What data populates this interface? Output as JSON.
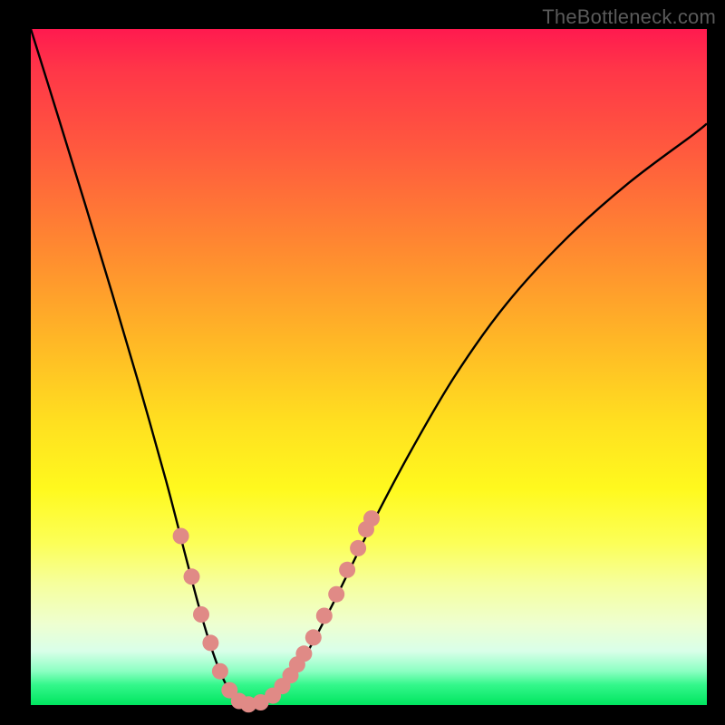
{
  "watermark": {
    "text": "TheBottleneck.com"
  },
  "colors": {
    "curve_stroke": "#000000",
    "marker_fill": "#e08a86",
    "marker_stroke": "#d67670"
  },
  "chart_data": {
    "type": "line",
    "title": "",
    "xlabel": "",
    "ylabel": "",
    "xlim": [
      0,
      1
    ],
    "ylim": [
      0,
      1
    ],
    "series": [
      {
        "name": "bottleneck-curve",
        "x": [
          0.0,
          0.04,
          0.08,
          0.12,
          0.16,
          0.2,
          0.228,
          0.248,
          0.264,
          0.278,
          0.29,
          0.3,
          0.312,
          0.326,
          0.342,
          0.36,
          0.382,
          0.41,
          0.448,
          0.5,
          0.56,
          0.628,
          0.704,
          0.79,
          0.884,
          0.98,
          1.0
        ],
        "y": [
          1.0,
          0.872,
          0.742,
          0.61,
          0.474,
          0.332,
          0.224,
          0.148,
          0.094,
          0.054,
          0.028,
          0.012,
          0.003,
          0.001,
          0.004,
          0.014,
          0.036,
          0.08,
          0.152,
          0.258,
          0.372,
          0.488,
          0.594,
          0.688,
          0.772,
          0.844,
          0.86
        ]
      }
    ],
    "markers": [
      {
        "x": 0.222,
        "y": 0.25
      },
      {
        "x": 0.238,
        "y": 0.19
      },
      {
        "x": 0.252,
        "y": 0.134
      },
      {
        "x": 0.266,
        "y": 0.092
      },
      {
        "x": 0.28,
        "y": 0.05
      },
      {
        "x": 0.294,
        "y": 0.022
      },
      {
        "x": 0.308,
        "y": 0.006
      },
      {
        "x": 0.322,
        "y": 0.001
      },
      {
        "x": 0.34,
        "y": 0.004
      },
      {
        "x": 0.358,
        "y": 0.014
      },
      {
        "x": 0.372,
        "y": 0.028
      },
      {
        "x": 0.384,
        "y": 0.044
      },
      {
        "x": 0.394,
        "y": 0.06
      },
      {
        "x": 0.404,
        "y": 0.076
      },
      {
        "x": 0.418,
        "y": 0.1
      },
      {
        "x": 0.434,
        "y": 0.132
      },
      {
        "x": 0.452,
        "y": 0.164
      },
      {
        "x": 0.468,
        "y": 0.2
      },
      {
        "x": 0.484,
        "y": 0.232
      },
      {
        "x": 0.496,
        "y": 0.26
      },
      {
        "x": 0.504,
        "y": 0.276
      }
    ]
  }
}
